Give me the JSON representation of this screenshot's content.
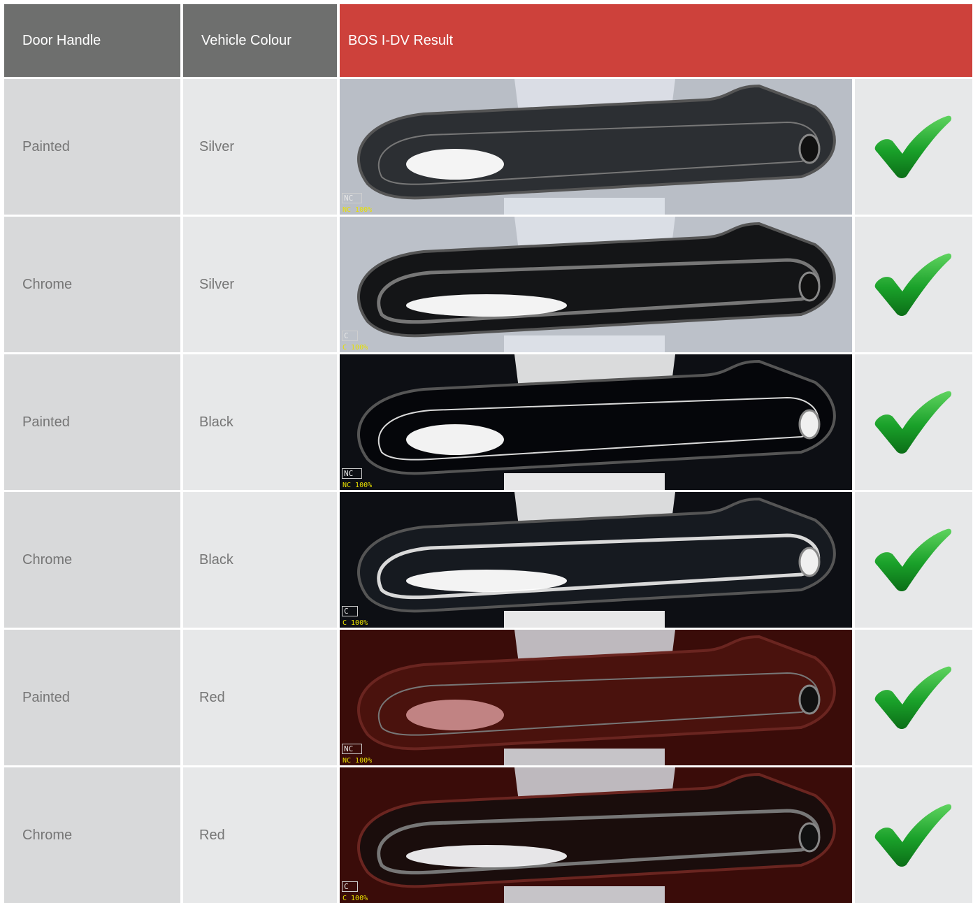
{
  "headers": {
    "door_handle": "Door Handle",
    "vehicle_colour": "Vehicle Colour",
    "result": "BOS I-DV Result"
  },
  "rows": [
    {
      "handle": "Painted",
      "colour": "Silver",
      "tag": "NC",
      "tag_pct": "NC 100%",
      "body_color": "#b9bec6",
      "handle_color": "#2c2f33",
      "result_icon": "green-checkmark-icon"
    },
    {
      "handle": "Chrome",
      "colour": "Silver",
      "tag": "C",
      "tag_pct": "C 100%",
      "body_color": "#bcc1c9",
      "handle_color": "#141517",
      "result_icon": "green-checkmark-icon"
    },
    {
      "handle": "Painted",
      "colour": "Black",
      "tag": "NC",
      "tag_pct": "NC 100%",
      "body_color": "#0d0f14",
      "handle_color": "#05060a",
      "result_icon": "green-checkmark-icon"
    },
    {
      "handle": "Chrome",
      "colour": "Black",
      "tag": "C",
      "tag_pct": "C 100%",
      "body_color": "#0d0f14",
      "handle_color": "#161a20",
      "result_icon": "green-checkmark-icon"
    },
    {
      "handle": "Painted",
      "colour": "Red",
      "tag": "NC",
      "tag_pct": "NC 100%",
      "body_color": "#3a0c09",
      "handle_color": "#4a120d",
      "result_icon": "green-checkmark-icon"
    },
    {
      "handle": "Chrome",
      "colour": "Red",
      "tag": "C",
      "tag_pct": "C 100%",
      "body_color": "#3a0c09",
      "handle_color": "#1a0d0c",
      "result_icon": "green-checkmark-icon"
    }
  ],
  "colors": {
    "header_grey": "#6e6f6e",
    "header_red": "#cd413b",
    "check_green": "#1aa12a"
  }
}
